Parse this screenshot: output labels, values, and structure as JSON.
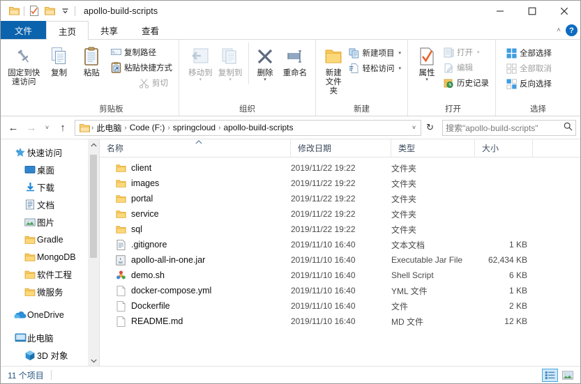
{
  "window": {
    "title": "apollo-build-scripts",
    "quick_access": [
      {
        "name": "folder-icon",
        "label": ""
      },
      {
        "name": "properties-icon",
        "label": ""
      },
      {
        "name": "new-folder-icon",
        "label": ""
      },
      {
        "name": "chevron-down-icon",
        "label": ""
      }
    ],
    "controls": {
      "minimize": "—",
      "maximize": "□",
      "close": "✕"
    }
  },
  "tabs": [
    {
      "id": "file",
      "label": "文件",
      "active": false,
      "accent": "#0b63ad"
    },
    {
      "id": "home",
      "label": "主页",
      "active": true
    },
    {
      "id": "share",
      "label": "共享",
      "active": false
    },
    {
      "id": "view",
      "label": "查看",
      "active": false
    }
  ],
  "tabstrip_right": {
    "collapse_ribbon": "˄",
    "help": "?"
  },
  "ribbon": {
    "groups": [
      {
        "id": "clipboard",
        "title": "剪贴板",
        "big_buttons": [
          {
            "id": "pin-to-quick-access",
            "label": "固定到快\n速访问",
            "icon": "pin-icon",
            "disabled": false
          },
          {
            "id": "copy",
            "label": "复制",
            "icon": "copy-icon",
            "disabled": false
          },
          {
            "id": "paste",
            "label": "粘贴",
            "icon": "paste-icon",
            "disabled": false
          }
        ],
        "small_buttons": [
          {
            "id": "cut",
            "label": "剪切",
            "icon": "scissors-icon",
            "disabled": true
          },
          {
            "id": "copy-path",
            "label": "复制路径",
            "icon": "copy-path-icon",
            "disabled": false
          },
          {
            "id": "paste-shortcut",
            "label": "粘贴快捷方式",
            "icon": "paste-shortcut-icon",
            "disabled": false
          }
        ]
      },
      {
        "id": "organize",
        "title": "组织",
        "big_buttons": [
          {
            "id": "move-to",
            "label": "移动到",
            "icon": "move-to-icon",
            "disabled": true,
            "caret": true
          },
          {
            "id": "copy-to",
            "label": "复制到",
            "icon": "copy-to-icon",
            "disabled": true,
            "caret": true
          },
          {
            "id": "delete",
            "label": "删除",
            "icon": "delete-x-icon",
            "disabled": false,
            "caret": true
          },
          {
            "id": "rename",
            "label": "重命名",
            "icon": "rename-icon",
            "disabled": false,
            "caret": false
          }
        ]
      },
      {
        "id": "new",
        "title": "新建",
        "big_buttons": [
          {
            "id": "new-folder",
            "label": "新建\n文件夹",
            "icon": "new-folder-icon",
            "disabled": false
          }
        ],
        "small_buttons": [
          {
            "id": "new-item",
            "label": "新建项目",
            "icon": "new-item-icon",
            "disabled": false,
            "caret": true
          },
          {
            "id": "easy-access",
            "label": "轻松访问",
            "icon": "easy-access-icon",
            "disabled": false,
            "caret": true
          }
        ]
      },
      {
        "id": "open",
        "title": "打开",
        "big_buttons": [
          {
            "id": "properties",
            "label": "属性",
            "icon": "properties-icon",
            "disabled": false,
            "caret": true
          }
        ],
        "small_buttons": [
          {
            "id": "open",
            "label": "打开",
            "icon": "open-icon",
            "disabled": true,
            "caret": true
          },
          {
            "id": "edit",
            "label": "编辑",
            "icon": "edit-icon",
            "disabled": true
          },
          {
            "id": "history",
            "label": "历史记录",
            "icon": "history-icon",
            "disabled": false
          }
        ]
      },
      {
        "id": "select",
        "title": "选择",
        "small_buttons": [
          {
            "id": "select-all",
            "label": "全部选择",
            "icon": "select-all-icon",
            "disabled": false
          },
          {
            "id": "select-none",
            "label": "全部取消",
            "icon": "select-none-icon",
            "disabled": true
          },
          {
            "id": "invert-selection",
            "label": "反向选择",
            "icon": "invert-selection-icon",
            "disabled": false
          }
        ]
      }
    ]
  },
  "addressbar": {
    "back": "←",
    "forward": "→",
    "recent": "˅",
    "up": "↑",
    "breadcrumbs": [
      "此电脑",
      "Code (F:)",
      "springcloud",
      "apollo-build-scripts"
    ],
    "separator": "›",
    "dropdown": "˅",
    "refresh": "↻",
    "search_placeholder": "搜索\"apollo-build-scripts\"",
    "search_value": ""
  },
  "navpane": {
    "items": [
      {
        "label": "快速访问",
        "icon": "quick-access-star-icon",
        "level": 0,
        "pinned": false
      },
      {
        "label": "桌面",
        "icon": "desktop-icon",
        "level": 1,
        "pinned": true
      },
      {
        "label": "下载",
        "icon": "downloads-icon",
        "level": 1,
        "pinned": true
      },
      {
        "label": "文档",
        "icon": "documents-icon",
        "level": 1,
        "pinned": true
      },
      {
        "label": "图片",
        "icon": "pictures-icon",
        "level": 1,
        "pinned": true
      },
      {
        "label": "Gradle",
        "icon": "folder-icon",
        "level": 1,
        "pinned": false
      },
      {
        "label": "MongoDB",
        "icon": "folder-icon",
        "level": 1,
        "pinned": false
      },
      {
        "label": "软件工程",
        "icon": "folder-icon",
        "level": 1,
        "pinned": false
      },
      {
        "label": "微服务",
        "icon": "folder-icon",
        "level": 1,
        "pinned": false
      },
      {
        "label": "OneDrive",
        "icon": "onedrive-cloud-icon",
        "level": 0,
        "pinned": false
      },
      {
        "label": "此电脑",
        "icon": "this-pc-icon",
        "level": 0,
        "pinned": false
      },
      {
        "label": "3D 对象",
        "icon": "3d-objects-icon",
        "level": 1,
        "pinned": false
      }
    ]
  },
  "filelist": {
    "columns": [
      {
        "key": "name",
        "label": "名称",
        "sorted": true,
        "sort_dir": "asc"
      },
      {
        "key": "date",
        "label": "修改日期",
        "sorted": false
      },
      {
        "key": "type",
        "label": "类型",
        "sorted": false
      },
      {
        "key": "size",
        "label": "大小",
        "sorted": false
      }
    ],
    "rows": [
      {
        "name": "client",
        "date": "2019/11/22 19:22",
        "type": "文件夹",
        "size": "",
        "icon": "folder-icon"
      },
      {
        "name": "images",
        "date": "2019/11/22 19:22",
        "type": "文件夹",
        "size": "",
        "icon": "folder-icon"
      },
      {
        "name": "portal",
        "date": "2019/11/22 19:22",
        "type": "文件夹",
        "size": "",
        "icon": "folder-icon"
      },
      {
        "name": "service",
        "date": "2019/11/22 19:22",
        "type": "文件夹",
        "size": "",
        "icon": "folder-icon"
      },
      {
        "name": "sql",
        "date": "2019/11/22 19:22",
        "type": "文件夹",
        "size": "",
        "icon": "folder-icon"
      },
      {
        "name": ".gitignore",
        "date": "2019/11/10 16:40",
        "type": "文本文档",
        "size": "1 KB",
        "icon": "text-file-icon"
      },
      {
        "name": "apollo-all-in-one.jar",
        "date": "2019/11/10 16:40",
        "type": "Executable Jar File",
        "size": "62,434 KB",
        "icon": "jar-file-icon"
      },
      {
        "name": "demo.sh",
        "date": "2019/11/10 16:40",
        "type": "Shell Script",
        "size": "6 KB",
        "icon": "shell-script-icon"
      },
      {
        "name": "docker-compose.yml",
        "date": "2019/11/10 16:40",
        "type": "YML 文件",
        "size": "1 KB",
        "icon": "generic-file-icon"
      },
      {
        "name": "Dockerfile",
        "date": "2019/11/10 16:40",
        "type": "文件",
        "size": "2 KB",
        "icon": "generic-file-icon"
      },
      {
        "name": "README.md",
        "date": "2019/11/10 16:40",
        "type": "MD 文件",
        "size": "12 KB",
        "icon": "generic-file-icon"
      }
    ]
  },
  "statusbar": {
    "item_count": "11 个项目",
    "views": [
      {
        "id": "details-view",
        "icon": "details-view-icon",
        "active": true
      },
      {
        "id": "large-icons-view",
        "icon": "large-icons-view-icon",
        "active": false
      }
    ]
  },
  "colors": {
    "accent": "#0b63ad",
    "folder_yellow": "#fcc75e",
    "status_text": "#25547e",
    "selection_blue": "#cde8f9"
  }
}
